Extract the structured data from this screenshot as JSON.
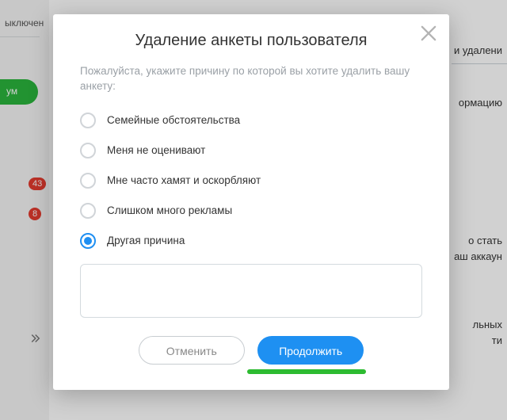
{
  "bg": {
    "sidebar": {
      "status_fragment": "ыключен",
      "pill_text": "ум",
      "badge1": "43",
      "badge2": "8"
    },
    "right": {
      "frag1": "и удалени",
      "frag2": "ормацию",
      "frag3": "о стать",
      "frag4": "аш аккаун",
      "frag5": "льных",
      "frag6": "ти"
    }
  },
  "modal": {
    "title": "Удаление анкеты пользователя",
    "prompt": "Пожалуйста, укажите причину по которой вы хотите удалить вашу анкету:",
    "options": [
      {
        "label": "Семейные обстоятельства",
        "selected": false
      },
      {
        "label": "Меня не оценивают",
        "selected": false
      },
      {
        "label": "Мне часто хамят и оскорбляют",
        "selected": false
      },
      {
        "label": "Слишком много рекламы",
        "selected": false
      },
      {
        "label": "Другая причина",
        "selected": true
      }
    ],
    "reason_value": "",
    "cancel_label": "Отменить",
    "continue_label": "Продолжить"
  }
}
